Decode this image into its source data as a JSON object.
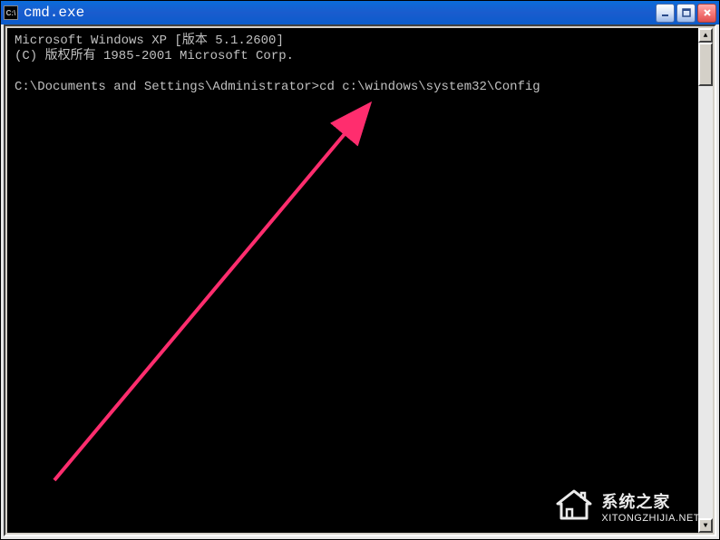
{
  "titlebar": {
    "icon_label": "C:\\",
    "title": "cmd.exe"
  },
  "terminal": {
    "line1": "Microsoft Windows XP [版本 5.1.2600]",
    "line2": "(C) 版权所有 1985-2001 Microsoft Corp.",
    "prompt": "C:\\Documents and Settings\\Administrator>",
    "command": "cd c:\\windows\\system32\\Config"
  },
  "watermark": {
    "title": "系统之家",
    "url": "XITONGZHIJIA.NET"
  },
  "scrollbar": {
    "up": "▲",
    "down": "▼"
  }
}
